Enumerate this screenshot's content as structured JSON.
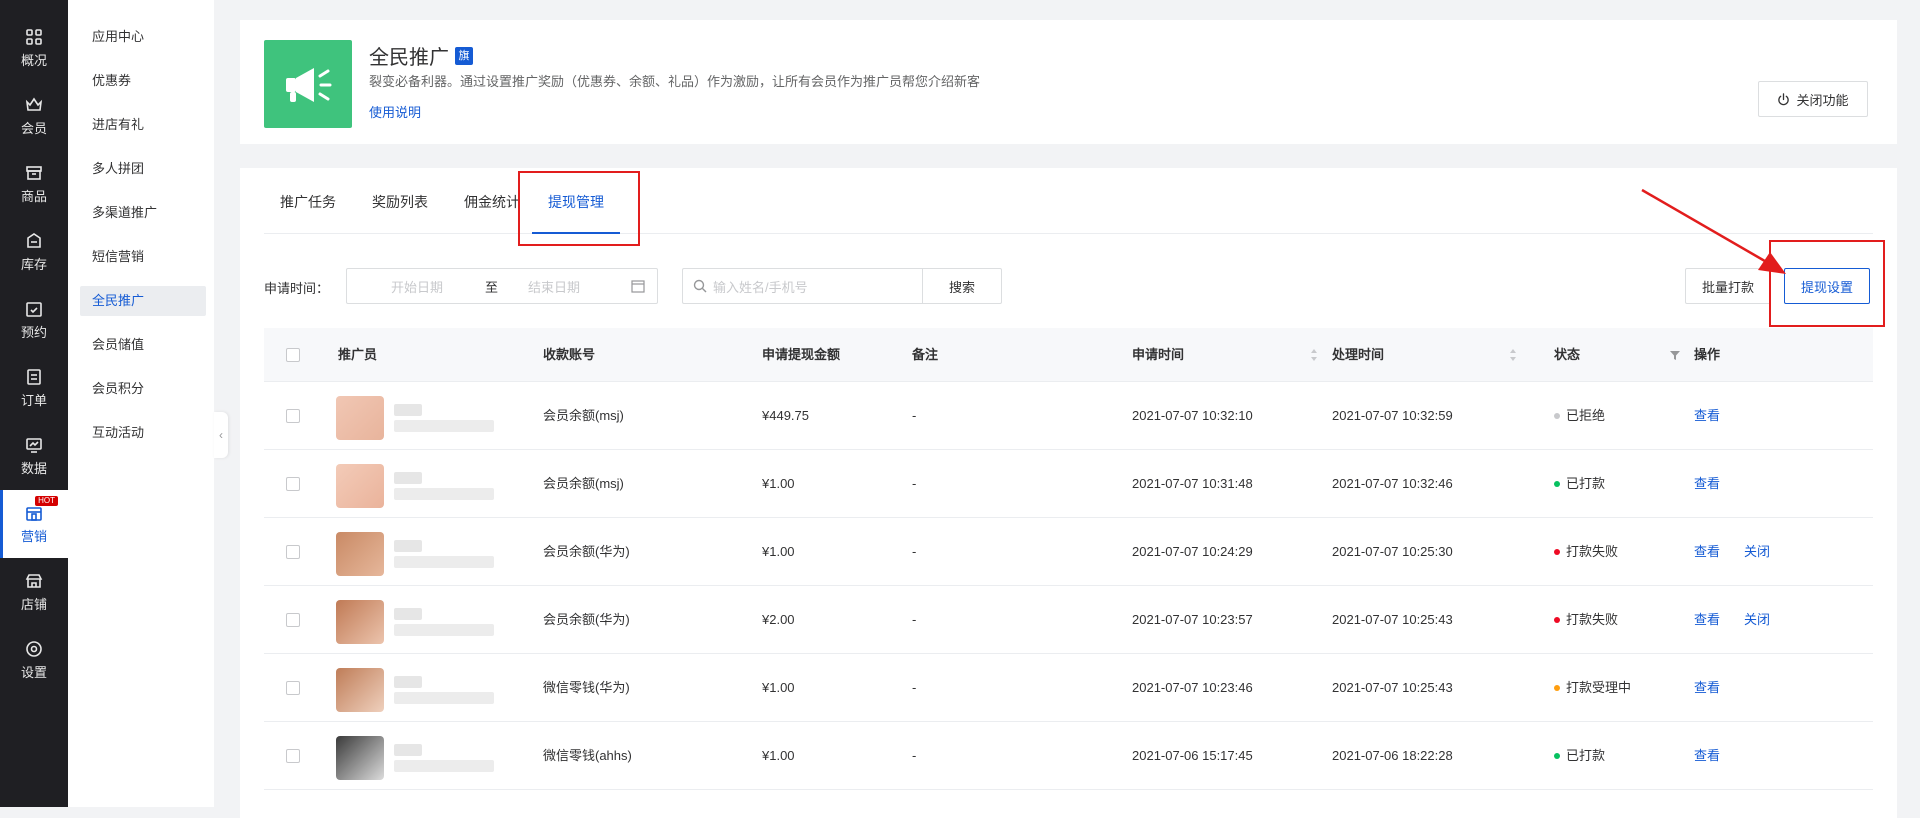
{
  "rail": [
    {
      "label": "概况",
      "icon": "overview-icon"
    },
    {
      "label": "会员",
      "icon": "member-icon"
    },
    {
      "label": "商品",
      "icon": "goods-icon"
    },
    {
      "label": "库存",
      "icon": "stock-icon"
    },
    {
      "label": "预约",
      "icon": "booking-icon"
    },
    {
      "label": "订单",
      "icon": "order-icon"
    },
    {
      "label": "数据",
      "icon": "data-icon"
    },
    {
      "label": "营销",
      "icon": "marketing-icon",
      "badge": "HOT"
    },
    {
      "label": "店铺",
      "icon": "shop-icon"
    },
    {
      "label": "设置",
      "icon": "settings-icon"
    }
  ],
  "subnav": [
    "应用中心",
    "优惠券",
    "进店有礼",
    "多人拼团",
    "多渠道推广",
    "短信营销",
    "全民推广",
    "会员储值",
    "会员积分",
    "互动活动"
  ],
  "header": {
    "title": "全民推广",
    "badge": "旗",
    "desc": "裂变必备利器。通过设置推广奖励（优惠券、余额、礼品）作为激励，让所有会员作为推广员帮您介绍新客",
    "help": "使用说明",
    "close_btn": "关闭功能"
  },
  "tabs": [
    "推广任务",
    "奖励列表",
    "佣金统计",
    "提现管理"
  ],
  "filter": {
    "label": "申请时间：",
    "start_placeholder": "开始日期",
    "sep": "至",
    "end_placeholder": "结束日期",
    "search_placeholder": "输入姓名/手机号",
    "search_btn": "搜索",
    "batch_btn": "批量打款",
    "settings_btn": "提现设置"
  },
  "table": {
    "columns": [
      "推广员",
      "收款账号",
      "申请提现金额",
      "备注",
      "申请时间",
      "处理时间",
      "状态",
      "操作"
    ],
    "rows": [
      {
        "account": "会员余额(msj)",
        "amount": "¥449.75",
        "note": "-",
        "apply": "2021-07-07 10:32:10",
        "process": "2021-07-07 10:32:59",
        "status": "已拒绝",
        "status_color": "#c8c9cc",
        "actions": [
          "查看"
        ]
      },
      {
        "account": "会员余额(msj)",
        "amount": "¥1.00",
        "note": "-",
        "apply": "2021-07-07 10:31:48",
        "process": "2021-07-07 10:32:46",
        "status": "已打款",
        "status_color": "#07c160",
        "actions": [
          "查看"
        ]
      },
      {
        "account": "会员余额(华为)",
        "amount": "¥1.00",
        "note": "-",
        "apply": "2021-07-07 10:24:29",
        "process": "2021-07-07 10:25:30",
        "status": "打款失败",
        "status_color": "#ee0a24",
        "actions": [
          "查看",
          "关闭"
        ]
      },
      {
        "account": "会员余额(华为)",
        "amount": "¥2.00",
        "note": "-",
        "apply": "2021-07-07 10:23:57",
        "process": "2021-07-07 10:25:43",
        "status": "打款失败",
        "status_color": "#ee0a24",
        "actions": [
          "查看",
          "关闭"
        ]
      },
      {
        "account": "微信零钱(华为)",
        "amount": "¥1.00",
        "note": "-",
        "apply": "2021-07-07 10:23:46",
        "process": "2021-07-07 10:25:43",
        "status": "打款受理中",
        "status_color": "#ff9e0f",
        "actions": [
          "查看"
        ]
      },
      {
        "account": "微信零钱(ahhs)",
        "amount": "¥1.00",
        "note": "-",
        "apply": "2021-07-06 15:17:45",
        "process": "2021-07-06 18:22:28",
        "status": "已打款",
        "status_color": "#07c160",
        "actions": [
          "查看"
        ]
      }
    ]
  },
  "colors": {
    "primary": "#155bd4",
    "brand_green": "#3fc37d",
    "highlight_red": "#e21d1d",
    "rail_bg": "#1f1f23"
  }
}
